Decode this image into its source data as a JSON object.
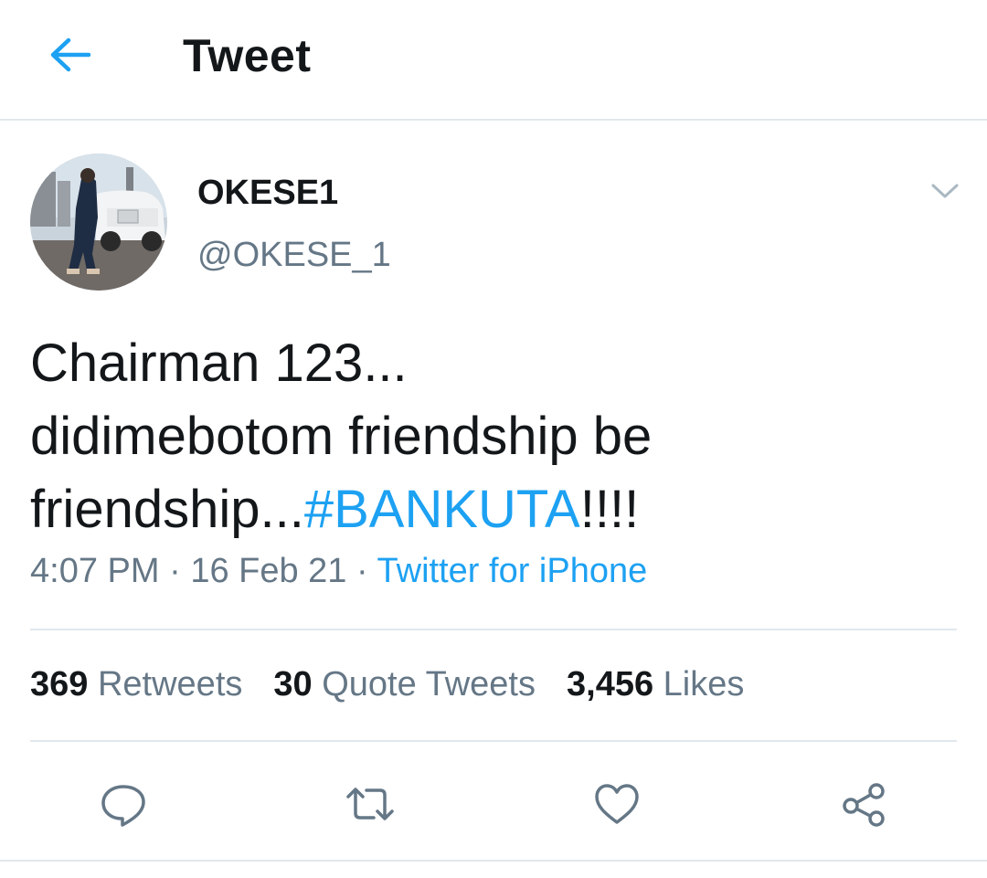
{
  "header": {
    "title": "Tweet",
    "back_icon": "arrow-left-icon"
  },
  "author": {
    "name": "OKESE1",
    "handle": "@OKESE_1",
    "avatar": "avatar-photo"
  },
  "tweet": {
    "line1": "Chairman 123...",
    "line2": "didimebotom friendship be",
    "line3_start": "friendship...",
    "hashtag": "#BANKUTA",
    "line3_end": "!!!!",
    "time": "4:07 PM",
    "date": "16 Feb 21",
    "source": "Twitter for iPhone",
    "separator": "·"
  },
  "stats": {
    "retweets_count": "369",
    "retweets_label": "Retweets",
    "quotes_count": "30",
    "quotes_label": "Quote Tweets",
    "likes_count": "3,456",
    "likes_label": "Likes"
  },
  "actions": {
    "reply_icon": "reply-icon",
    "retweet_icon": "retweet-icon",
    "like_icon": "heart-icon",
    "share_icon": "share-icon"
  },
  "colors": {
    "accent": "#1da1f2",
    "text": "#14171a",
    "secondary": "#657786",
    "divider": "#e1e8ed"
  }
}
